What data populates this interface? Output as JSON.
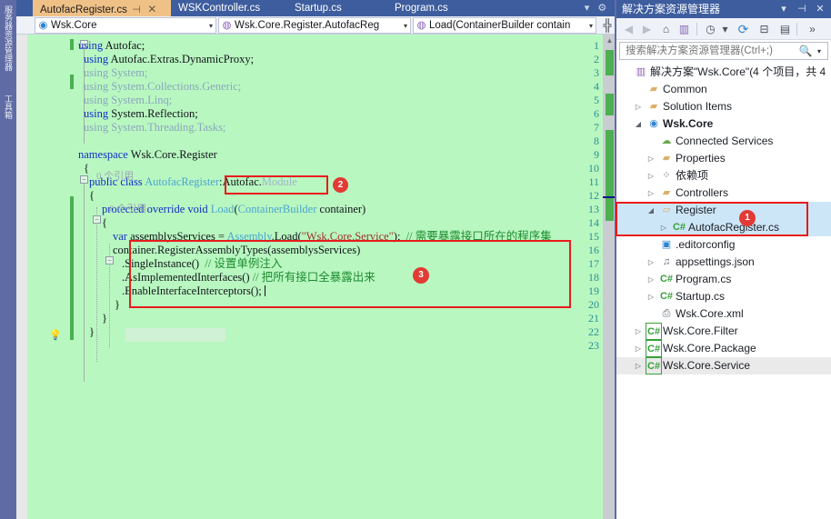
{
  "vertical_dock": {
    "tabs": [
      "服务器资源管理器",
      "工具箱"
    ]
  },
  "editor": {
    "tabs": [
      {
        "label": "AutofacRegister.cs",
        "active": true,
        "pin": "⊣",
        "close": "✕"
      },
      {
        "label": "WSKController.cs",
        "active": false
      },
      {
        "label": "Startup.cs",
        "active": false
      },
      {
        "label": "Program.cs",
        "active": false
      }
    ],
    "tabbar_overflow": "▾",
    "tabbar_settings": "⚙",
    "nav": {
      "project": "Wsk.Core",
      "project_icon": "globe-icon",
      "type": "Wsk.Core.Register.AutofacReg",
      "type_icon": "class-icon",
      "member": "Load(ContainerBuilder contain",
      "member_icon": "method-icon",
      "split_button": "╬",
      "dropdown_arrow": "▾"
    },
    "lines": [
      {
        "n": 1,
        "tokens": [
          [
            "kw",
            "using"
          ],
          [
            "plain",
            " Autofac;"
          ]
        ]
      },
      {
        "n": 2,
        "tokens": [
          [
            "kw",
            "using"
          ],
          [
            "plain",
            " Autofac.Extras.DynamicProxy;"
          ]
        ]
      },
      {
        "n": 3,
        "tokens": [
          [
            "dim",
            "using System;"
          ]
        ]
      },
      {
        "n": 4,
        "tokens": [
          [
            "dim",
            "using System.Collections.Generic;"
          ]
        ]
      },
      {
        "n": 5,
        "tokens": [
          [
            "dim",
            "using System.Linq;"
          ]
        ]
      },
      {
        "n": 6,
        "tokens": [
          [
            "kw",
            "using"
          ],
          [
            "plain",
            " System.Reflection;"
          ]
        ]
      },
      {
        "n": 7,
        "tokens": [
          [
            "dim",
            "using System.Threading.Tasks;"
          ]
        ]
      },
      {
        "n": 8,
        "tokens": []
      },
      {
        "n": 9,
        "tokens": [
          [
            "kw",
            "namespace"
          ],
          [
            "plain",
            " Wsk.Core.Register"
          ]
        ]
      },
      {
        "n": 10,
        "tokens": [
          [
            "plain",
            "{"
          ]
        ]
      },
      {
        "n": 11,
        "tokens": [
          [
            "kw",
            "public class"
          ],
          [
            "type",
            " AutofacRegister"
          ],
          [
            "plain",
            ":"
          ],
          [
            "plain",
            "Autofac."
          ],
          [
            "typeg",
            "Module"
          ]
        ]
      },
      {
        "n": 12,
        "tokens": [
          [
            "plain",
            "{"
          ]
        ]
      },
      {
        "n": 13,
        "tokens": [
          [
            "kw",
            "protected override void"
          ],
          [
            "type",
            " Load"
          ],
          [
            "plain",
            "("
          ],
          [
            "type",
            "ContainerBuilder"
          ],
          [
            "plain",
            " container)"
          ]
        ]
      },
      {
        "n": 14,
        "tokens": [
          [
            "plain",
            "{"
          ]
        ]
      },
      {
        "n": 15,
        "tokens": [
          [
            "kw",
            "var"
          ],
          [
            "plain",
            " assemblysServices = "
          ],
          [
            "type",
            "Assembly"
          ],
          [
            "plain",
            ".Load("
          ],
          [
            "str",
            "\"Wsk.Core.Service\""
          ],
          [
            "plain",
            ");  "
          ],
          [
            "cmt",
            "// 需要暴露接口所在的程序集"
          ]
        ]
      },
      {
        "n": 16,
        "tokens": [
          [
            "plain",
            "container.RegisterAssemblyTypes(assemblysServices)"
          ]
        ]
      },
      {
        "n": 17,
        "tokens": [
          [
            "plain",
            ".SingleInstance()  "
          ],
          [
            "cmt",
            "// 设置单例注入"
          ]
        ]
      },
      {
        "n": 18,
        "tokens": [
          [
            "plain",
            ".AsImplementedInterfaces() "
          ],
          [
            "cmt",
            "// 把所有接口全暴露出来"
          ]
        ]
      },
      {
        "n": 19,
        "tokens": [
          [
            "plain",
            ".EnableInterfaceInterceptors();"
          ]
        ]
      },
      {
        "n": 20,
        "tokens": [
          [
            "plain",
            "}"
          ]
        ]
      },
      {
        "n": 21,
        "tokens": [
          [
            "plain",
            "}"
          ]
        ]
      },
      {
        "n": 22,
        "tokens": [
          [
            "plain",
            "}"
          ]
        ]
      },
      {
        "n": 23,
        "tokens": []
      }
    ],
    "codelens": {
      "class_ref": "0 个引用",
      "method_ref": "0 个引用"
    },
    "lightbulb_line": 19,
    "lightbulb_glyph": "💡"
  },
  "annotations": [
    {
      "id": "1",
      "label": "1"
    },
    {
      "id": "2",
      "label": "2"
    },
    {
      "id": "3",
      "label": "3"
    }
  ],
  "solution_explorer": {
    "title": "解决方案资源管理器",
    "title_controls": {
      "dropdown": "▾",
      "pin": "⊣",
      "close": "✕"
    },
    "toolbar": [
      {
        "name": "back-icon",
        "glyph": "◀",
        "disabled": true
      },
      {
        "name": "forward-icon",
        "glyph": "▶",
        "disabled": true
      },
      {
        "name": "home-icon",
        "glyph": "⌂",
        "disabled": false
      },
      {
        "name": "solution-icon",
        "glyph": "▥",
        "disabled": false
      },
      {
        "name": "pending-changes-icon",
        "glyph": "◷",
        "disabled": false
      },
      {
        "name": "pending-changes-dropdown-icon",
        "glyph": "▾",
        "disabled": false
      },
      {
        "name": "refresh-icon",
        "glyph": "⟳",
        "disabled": false
      },
      {
        "name": "collapse-all-icon",
        "glyph": "⊟",
        "disabled": false
      },
      {
        "name": "properties-icon",
        "glyph": "▤",
        "disabled": false
      },
      {
        "name": "overflow-icon",
        "glyph": "»",
        "disabled": false
      }
    ],
    "search": {
      "placeholder": "搜索解决方案资源管理器(Ctrl+;)",
      "value": "",
      "magnifier": "🔍",
      "dropdown": "▾"
    },
    "tree": [
      {
        "indent": 0,
        "expander": "",
        "icon": "solution-icon",
        "iconglyph": "▥",
        "iconclass": "wirefr",
        "label": "解决方案\"Wsk.Core\"(4 个项目，共 4",
        "bold": false,
        "state": ""
      },
      {
        "indent": 1,
        "expander": "",
        "icon": "folder-icon",
        "iconglyph": "▰",
        "iconclass": "folder",
        "label": "Common",
        "bold": false,
        "state": ""
      },
      {
        "indent": 1,
        "expander": "▷",
        "icon": "folder-icon",
        "iconglyph": "▰",
        "iconclass": "folder",
        "label": "Solution Items",
        "bold": false,
        "state": ""
      },
      {
        "indent": 1,
        "expander": "◢",
        "icon": "project-icon",
        "iconglyph": "◉",
        "iconclass": "globe",
        "label": "Wsk.Core",
        "bold": true,
        "state": ""
      },
      {
        "indent": 2,
        "expander": "",
        "icon": "connected-services-icon",
        "iconglyph": "☁",
        "iconclass": "cloud",
        "label": "Connected Services",
        "bold": false,
        "state": ""
      },
      {
        "indent": 2,
        "expander": "▷",
        "icon": "properties-icon",
        "iconglyph": "▰",
        "iconclass": "folder",
        "label": "Properties",
        "bold": false,
        "state": ""
      },
      {
        "indent": 2,
        "expander": "▷",
        "icon": "dependencies-icon",
        "iconglyph": "⁘",
        "iconclass": "depico",
        "label": "依赖项",
        "bold": false,
        "state": ""
      },
      {
        "indent": 2,
        "expander": "▷",
        "icon": "folder-icon",
        "iconglyph": "▰",
        "iconclass": "folder",
        "label": "Controllers",
        "bold": false,
        "state": ""
      },
      {
        "indent": 2,
        "expander": "◢",
        "icon": "folder-open-icon",
        "iconglyph": "▱",
        "iconclass": "folder",
        "label": "Register",
        "bold": false,
        "state": "selected"
      },
      {
        "indent": 3,
        "expander": "▷",
        "icon": "csharp-file-icon",
        "iconglyph": "C#",
        "iconclass": "cs",
        "label": "AutofacRegister.cs",
        "bold": false,
        "state": "selected"
      },
      {
        "indent": 2,
        "expander": "",
        "icon": "editorconfig-icon",
        "iconglyph": "▣",
        "iconclass": "editico",
        "label": ".editorconfig",
        "bold": false,
        "state": ""
      },
      {
        "indent": 2,
        "expander": "▷",
        "icon": "json-file-icon",
        "iconglyph": "♫",
        "iconclass": "jsonico",
        "label": "appsettings.json",
        "bold": false,
        "state": ""
      },
      {
        "indent": 2,
        "expander": "▷",
        "icon": "csharp-file-icon",
        "iconglyph": "C#",
        "iconclass": "cs",
        "label": "Program.cs",
        "bold": false,
        "state": ""
      },
      {
        "indent": 2,
        "expander": "▷",
        "icon": "csharp-file-icon",
        "iconglyph": "C#",
        "iconclass": "cs",
        "label": "Startup.cs",
        "bold": false,
        "state": ""
      },
      {
        "indent": 2,
        "expander": "",
        "icon": "xml-file-icon",
        "iconglyph": "⎙",
        "iconclass": "xmlico",
        "label": "Wsk.Core.xml",
        "bold": false,
        "state": ""
      },
      {
        "indent": 1,
        "expander": "▷",
        "icon": "csharp-project-icon",
        "iconglyph": "C#",
        "iconclass": "csp",
        "label": "Wsk.Core.Filter",
        "bold": false,
        "state": ""
      },
      {
        "indent": 1,
        "expander": "▷",
        "icon": "csharp-project-icon",
        "iconglyph": "C#",
        "iconclass": "csp",
        "label": "Wsk.Core.Package",
        "bold": false,
        "state": ""
      },
      {
        "indent": 1,
        "expander": "▷",
        "icon": "csharp-project-icon",
        "iconglyph": "C#",
        "iconclass": "csp",
        "label": "Wsk.Core.Service",
        "bold": false,
        "state": "hover"
      }
    ]
  },
  "colors": {
    "accent_blue": "#3d5d9e",
    "active_tab": "#f0c187",
    "code_background": "#b4f5bc",
    "annotation_red": "#e81b1b",
    "badge_red": "#e23a34",
    "selection_blue": "#cde6f7",
    "change_green": "#4caf50"
  }
}
